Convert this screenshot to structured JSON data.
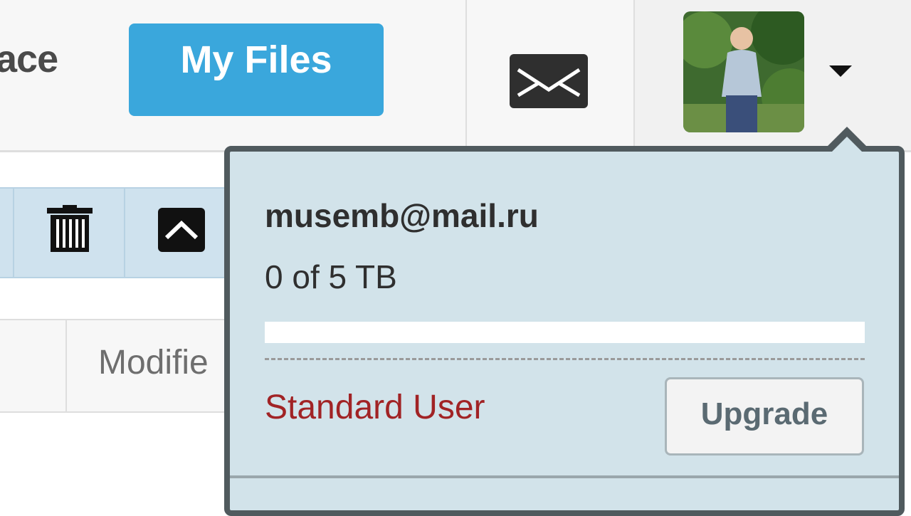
{
  "header": {
    "workspace_text": "ace",
    "my_files_label": "My Files"
  },
  "toolbar": {
    "icons": [
      "trash-icon",
      "chevron-up-icon"
    ]
  },
  "table": {
    "modified_header": "Modifie"
  },
  "account_menu": {
    "email": "musemb@mail.ru",
    "usage_text": "0 of 5 TB",
    "storage_used_fraction": 0,
    "plan_label": "Standard User",
    "upgrade_label": "Upgrade"
  },
  "colors": {
    "accent": "#3aa7dc",
    "dropdown_bg": "#d2e3ea",
    "plan_text": "#a12325",
    "toolbar_bg": "#cfe2ee"
  }
}
